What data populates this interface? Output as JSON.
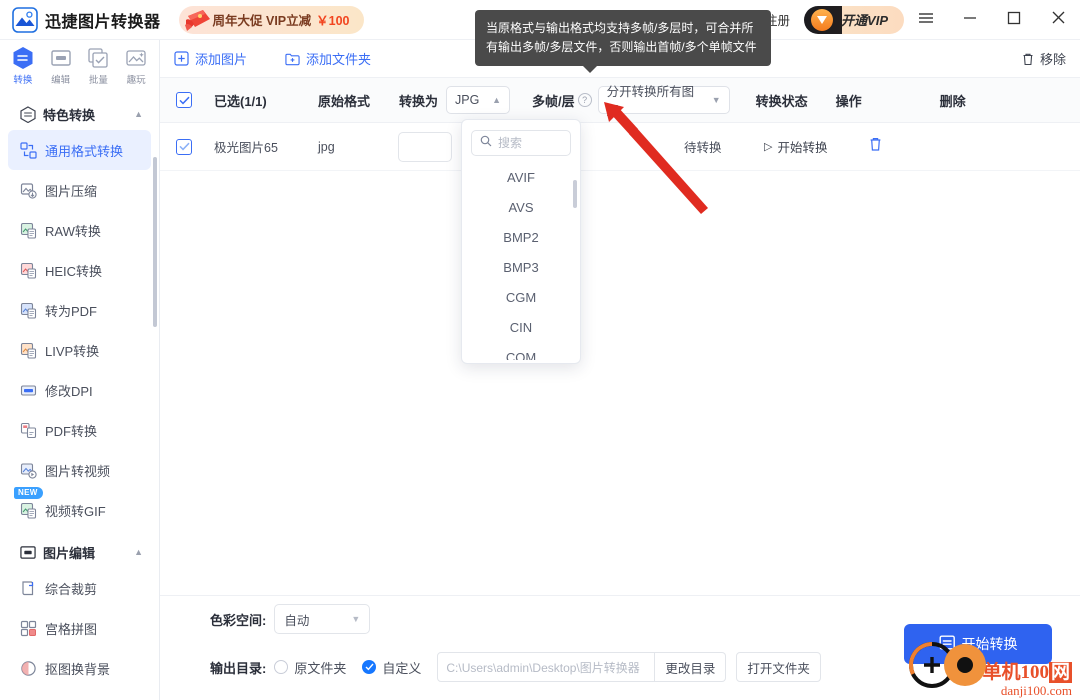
{
  "titlebar": {
    "brand_name": "迅捷图片转换器",
    "promo_text": "周年大促 VIP立减",
    "promo_price": "￥100",
    "login_label": "登录/注册",
    "vip_label_cn": "开通",
    "vip_label_en": "VIP",
    "menu_icon": "hamburger-icon",
    "minimize_icon": "minimize-icon",
    "maximize_icon": "maximize-icon",
    "close_icon": "close-icon"
  },
  "sidebar": {
    "mode_tabs": [
      {
        "label": "转换",
        "icon": "convert-icon",
        "active": true
      },
      {
        "label": "编辑",
        "icon": "edit-icon",
        "active": false
      },
      {
        "label": "批量",
        "icon": "batch-icon",
        "active": false
      },
      {
        "label": "趣玩",
        "icon": "fun-icon",
        "active": false
      }
    ],
    "groups": [
      {
        "title": "特色转换",
        "icon": "feature-convert-icon",
        "collapse_icon": "chevron-up-icon",
        "items": [
          {
            "label": "通用格式转换",
            "icon": "general-format-icon",
            "active": true,
            "badge": ""
          },
          {
            "label": "图片压缩",
            "icon": "compress-icon",
            "active": false,
            "badge": ""
          },
          {
            "label": "RAW转换",
            "icon": "raw-icon",
            "active": false,
            "badge": ""
          },
          {
            "label": "HEIC转换",
            "icon": "heic-icon",
            "active": false,
            "badge": ""
          },
          {
            "label": "转为PDF",
            "icon": "to-pdf-icon",
            "active": false,
            "badge": ""
          },
          {
            "label": "LIVP转换",
            "icon": "livp-icon",
            "active": false,
            "badge": ""
          },
          {
            "label": "修改DPI",
            "icon": "dpi-icon",
            "active": false,
            "badge": ""
          },
          {
            "label": "PDF转换",
            "icon": "pdf-convert-icon",
            "active": false,
            "badge": ""
          },
          {
            "label": "图片转视频",
            "icon": "image-to-video-icon",
            "active": false,
            "badge": ""
          },
          {
            "label": "视频转GIF",
            "icon": "video-to-gif-icon",
            "active": false,
            "badge": "NEW"
          }
        ]
      },
      {
        "title": "图片编辑",
        "icon": "image-edit-icon",
        "collapse_icon": "chevron-up-icon",
        "items": [
          {
            "label": "综合裁剪",
            "icon": "crop-icon",
            "active": false,
            "badge": ""
          },
          {
            "label": "宫格拼图",
            "icon": "grid-puzzle-icon",
            "active": false,
            "badge": ""
          },
          {
            "label": "抠图换背景",
            "icon": "remove-bg-icon",
            "active": false,
            "badge": ""
          }
        ]
      }
    ]
  },
  "toolbar": {
    "add_image_label": "添加图片",
    "add_folder_label": "添加文件夹",
    "remove_label": "移除"
  },
  "table": {
    "headers": {
      "selected": "已选(1/1)",
      "source_format": "原始格式",
      "convert_to": "转换为",
      "multi_frame": "多帧/层",
      "status": "转换状态",
      "action": "操作",
      "delete": "删除"
    },
    "convert_to_value": "JPG",
    "convert_to_caret": "chevron-up-icon",
    "multi_frame_value": "分开转换所有图层",
    "multi_frame_caret": "chevron-down-icon",
    "help_icon": "question-mark-icon",
    "rows": [
      {
        "checked": true,
        "name": "极光图片65",
        "source_format": "jpg",
        "convert_to": "",
        "status": "待转换",
        "action": "开始转换",
        "action_icon": "play-icon",
        "delete_icon": "trash-icon"
      }
    ]
  },
  "format_dropdown": {
    "search_placeholder": "搜索",
    "search_value": "",
    "search_icon": "search-icon",
    "options": [
      "AVIF",
      "AVS",
      "BMP2",
      "BMP3",
      "CGM",
      "CIN",
      "COM"
    ]
  },
  "tooltip": {
    "text": "当原格式与输出格式均支持多帧/多层时，可合并所有输出多帧/多层文件，否则输出首帧/多个单帧文件"
  },
  "bottom": {
    "color_space_label": "色彩空间:",
    "color_space_value": "自动",
    "color_space_caret": "chevron-down-icon",
    "output_dir_label": "输出目录:",
    "option_original": "原文件夹",
    "option_custom": "自定义",
    "custom_selected": true,
    "path_value": "C:\\Users\\admin\\Desktop\\图片转换器",
    "change_dir_label": "更改目录",
    "open_folder_label": "打开文件夹",
    "start_button_label": "开始转换",
    "start_button_icon": "convert-icon",
    "accent_color": "#2f63f0"
  },
  "watermark": {
    "line1_a": "单机100",
    "line1_b": "网",
    "line2": "danji100.com"
  },
  "colors": {
    "accent": "#3b6ef5",
    "accent_button": "#2f63f0",
    "sidebar_active_bg": "#eaf0ff",
    "tooltip_bg": "#4a4a4a",
    "promo_price": "#f2451f",
    "watermark": "#e8502a",
    "annotation_arrow": "#e02b20"
  }
}
